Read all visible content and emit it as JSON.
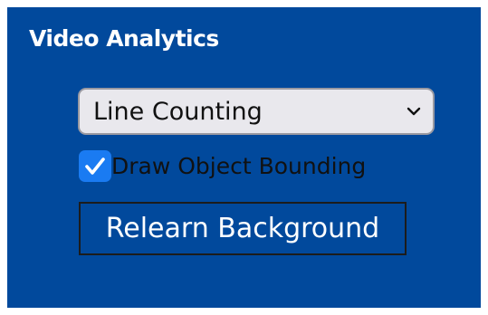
{
  "panel": {
    "title": "Video Analytics",
    "background_color": "#01499c"
  },
  "mode_select": {
    "selected": "Line Counting",
    "icon": "chevron-down-icon"
  },
  "draw_bounding": {
    "label": "Draw Object Bounding",
    "checked": true,
    "accent_color": "#1a7bf2",
    "icon": "checkmark-icon"
  },
  "relearn": {
    "label": "Relearn Background"
  }
}
